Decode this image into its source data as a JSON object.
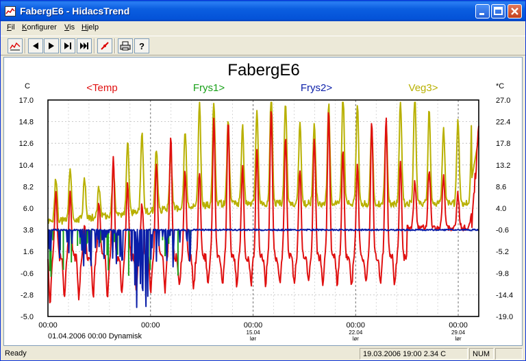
{
  "window": {
    "title": "FabergE6 - HidacsTrend"
  },
  "menu": [
    "Fil",
    "Konfigurer",
    "Vis",
    "Hjelp"
  ],
  "toolbar": {
    "buttons": [
      "chart-icon",
      "first-icon",
      "play-icon",
      "next-end-icon",
      "last-icon",
      "marker-icon",
      "print-icon",
      "help-icon"
    ]
  },
  "status": {
    "ready": "Ready",
    "datetime_value": "19.03.2006 19:00  2.34 C",
    "num": "NUM"
  },
  "chart_data": {
    "type": "line",
    "title": "FabergE6",
    "left_axis_unit": "C",
    "right_axis_unit": "*C",
    "series": [
      {
        "name": "<Temp",
        "color": "#e01010",
        "axis": "left"
      },
      {
        "name": "Frys1>",
        "color": "#18a018",
        "axis": "right"
      },
      {
        "name": "Frys2>",
        "color": "#0a1ea8",
        "axis": "right"
      },
      {
        "name": "Veg3>",
        "color": "#b8b000",
        "axis": "right"
      }
    ],
    "left_ticks": [
      "17.0",
      "14.8",
      "12.6",
      "10.4",
      "8.2",
      "6.0",
      "3.8",
      "1.6",
      "-0.6",
      "-2.8",
      "-5.0"
    ],
    "right_ticks": [
      "27.0",
      "22.4",
      "17.8",
      "13.2",
      "8.6",
      "4.0",
      "-0.6",
      "-5.2",
      "-9.8",
      "-14.4",
      "-19.0"
    ],
    "ylim_left": [
      -5.0,
      17.0
    ],
    "ylim_right": [
      -19.0,
      27.0
    ],
    "x_ticks": [
      {
        "time": "00:00",
        "date": "",
        "day": ""
      },
      {
        "time": "00:00",
        "date": "",
        "day": ""
      },
      {
        "time": "00:00",
        "date": "15.04",
        "day": "lør"
      },
      {
        "time": "00:00",
        "date": "22.04",
        "day": "lør"
      },
      {
        "time": "00:00",
        "date": "29.04",
        "day": "lør"
      }
    ],
    "footer": "01.04.2006 00:00 Dynamisk",
    "grid": true
  }
}
